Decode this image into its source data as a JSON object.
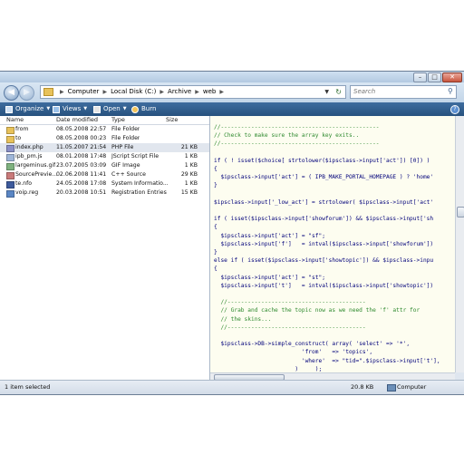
{
  "address": {
    "crumbs": [
      "Computer",
      "Local Disk (C:)",
      "Archive",
      "web"
    ]
  },
  "search": {
    "placeholder": "Search"
  },
  "toolbar": {
    "organize": "Organize",
    "views": "Views",
    "open": "Open",
    "burn": "Burn"
  },
  "files": {
    "columns": {
      "name": "Name",
      "date": "Date modified",
      "type": "Type",
      "size": "Size"
    },
    "rows": [
      {
        "name": "from",
        "date": "08.05.2008 22:57",
        "type": "File Folder",
        "size": "",
        "icon": "folder-icon"
      },
      {
        "name": "to",
        "date": "08.05.2008 00:23",
        "type": "File Folder",
        "size": "",
        "icon": "folder-icon"
      },
      {
        "name": "index.php",
        "date": "11.05.2007 21:54",
        "type": "PHP File",
        "size": "21 KB",
        "icon": "php-file-icon"
      },
      {
        "name": "ipb_pm.js",
        "date": "08.01.2008 17:48",
        "type": "JScript Script File",
        "size": "1 KB",
        "icon": "script-file-icon"
      },
      {
        "name": "largeminus.gif",
        "date": "23.07.2005 03:09",
        "type": "GIF Image",
        "size": "1 KB",
        "icon": "image-file-icon"
      },
      {
        "name": "SourcePrevie...",
        "date": "02.06.2008 11:41",
        "type": "C++ Source",
        "size": "29 KB",
        "icon": "cpp-file-icon"
      },
      {
        "name": "te.nfo",
        "date": "24.05.2008 17:08",
        "type": "System Informatio...",
        "size": "1 KB",
        "icon": "info-file-icon"
      },
      {
        "name": "voip.reg",
        "date": "20.03.2008 10:51",
        "type": "Registration Entries",
        "size": "15 KB",
        "icon": "registry-file-icon"
      }
    ]
  },
  "code": {
    "lines": [
      {
        "text": "//-----------------------------------------------",
        "kind": "cm"
      },
      {
        "text": "// Check to make sure the array key exits..",
        "kind": "cm"
      },
      {
        "text": "//-----------------------------------------------",
        "kind": "cm"
      },
      {
        "text": "",
        "kind": "kw"
      },
      {
        "text": "if ( ! isset($choice[ strtolower($ipsclass->input['act']) [0]) )",
        "kind": "kw"
      },
      {
        "text": "{",
        "kind": "kw"
      },
      {
        "text": "  $ipsclass->input['act'] = ( IPB_MAKE_PORTAL_HOMEPAGE ) ? 'home'",
        "kind": "kw"
      },
      {
        "text": "}",
        "kind": "kw"
      },
      {
        "text": "",
        "kind": "kw"
      },
      {
        "text": "$ipsclass->input['_low_act'] = strtolower( $ipsclass->input['act'",
        "kind": "kw"
      },
      {
        "text": "",
        "kind": "kw"
      },
      {
        "text": "if ( isset($ipsclass->input['showforum']) && $ipsclass->input['sh",
        "kind": "kw"
      },
      {
        "text": "{",
        "kind": "kw"
      },
      {
        "text": "  $ipsclass->input['act'] = \"sf\";",
        "kind": "kw"
      },
      {
        "text": "  $ipsclass->input['f']   = intval($ipsclass->input['showforum'])",
        "kind": "kw"
      },
      {
        "text": "}",
        "kind": "kw"
      },
      {
        "text": "else if ( isset($ipsclass->input['showtopic']) && $ipsclass->inpu",
        "kind": "kw"
      },
      {
        "text": "{",
        "kind": "kw"
      },
      {
        "text": "  $ipsclass->input['act'] = \"st\";",
        "kind": "kw"
      },
      {
        "text": "  $ipsclass->input['t']   = intval($ipsclass->input['showtopic'])",
        "kind": "kw"
      },
      {
        "text": "",
        "kind": "kw"
      },
      {
        "text": "  //-----------------------------------------",
        "kind": "cm"
      },
      {
        "text": "  // Grab and cache the topic now as we need the 'f' attr for",
        "kind": "cm"
      },
      {
        "text": "  // the skins...",
        "kind": "cm"
      },
      {
        "text": "  //-----------------------------------------",
        "kind": "cm"
      },
      {
        "text": "",
        "kind": "kw"
      },
      {
        "text": "  $ipsclass->DB->simple_construct( array( 'select' => '*',",
        "kind": "kw"
      },
      {
        "text": "                          'from'   => 'topics',",
        "kind": "kw"
      },
      {
        "text": "                          'where'  => \"tid=\".$ipsclass->input['t'],",
        "kind": "kw"
      },
      {
        "text": "                        )     );",
        "kind": "kw"
      }
    ]
  },
  "status": {
    "selection": "1 item selected",
    "size": "20.8 KB",
    "location": "Computer"
  }
}
